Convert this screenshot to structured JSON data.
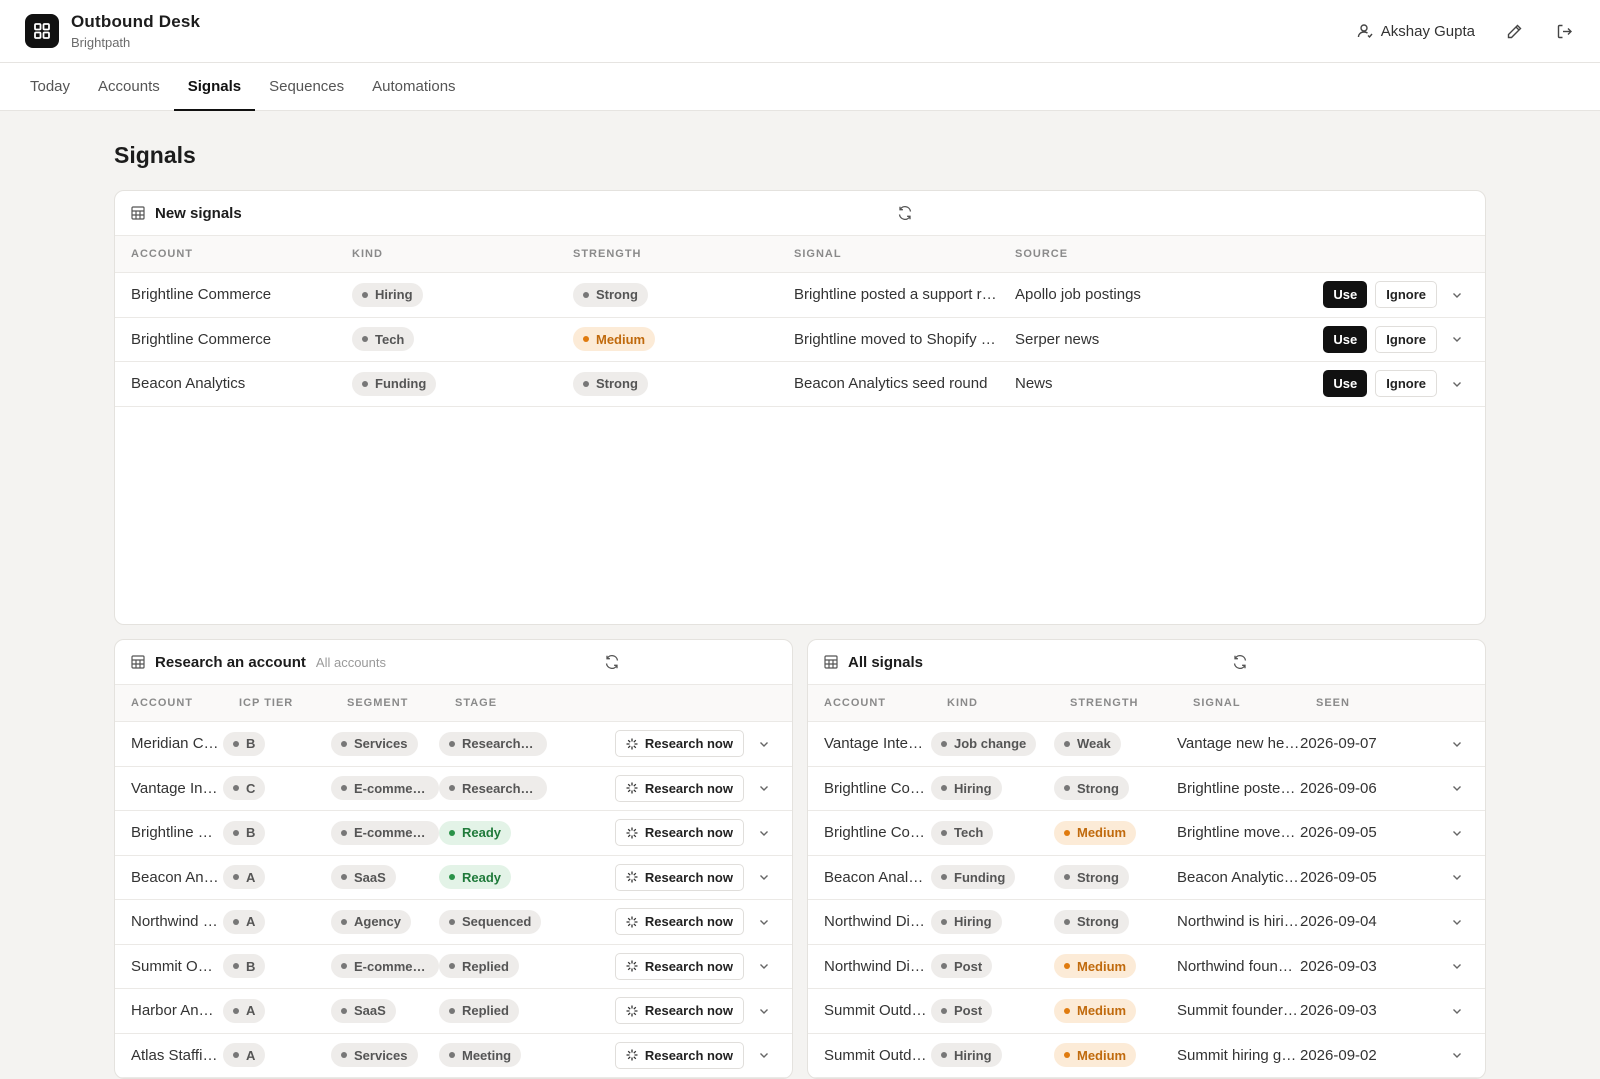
{
  "app": {
    "title": "Outbound Desk",
    "workspace": "Brightpath",
    "user": "Akshay Gupta"
  },
  "tabs": [
    {
      "label": "Today",
      "active": false
    },
    {
      "label": "Accounts",
      "active": false
    },
    {
      "label": "Signals",
      "active": true
    },
    {
      "label": "Sequences",
      "active": false
    },
    {
      "label": "Automations",
      "active": false
    }
  ],
  "page_title": "Signals",
  "new_signals": {
    "title": "New signals",
    "columns": [
      "ACCOUNT",
      "KIND",
      "STRENGTH",
      "SIGNAL",
      "SOURCE"
    ],
    "use_label": "Use",
    "ignore_label": "Ignore",
    "rows": [
      {
        "account": "Brightline Commerce",
        "kind": "Hiring",
        "strength": "Strong",
        "signal": "Brightline posted a support role",
        "source": "Apollo job postings"
      },
      {
        "account": "Brightline Commerce",
        "kind": "Tech",
        "strength": "Medium",
        "signal": "Brightline moved to Shopify Plus",
        "source": "Serper news"
      },
      {
        "account": "Beacon Analytics",
        "kind": "Funding",
        "strength": "Strong",
        "signal": "Beacon Analytics seed round",
        "source": "News"
      }
    ]
  },
  "research": {
    "title": "Research an account",
    "subtitle": "All accounts",
    "columns": [
      "ACCOUNT",
      "ICP TIER",
      "SEGMENT",
      "STAGE"
    ],
    "button_label": "Research now",
    "rows": [
      {
        "account": "Meridian Consulting",
        "tier": "B",
        "segment": "Services",
        "stage": "Researching"
      },
      {
        "account": "Vantage Interiors",
        "tier": "C",
        "segment": "E-commerce",
        "stage": "Researching"
      },
      {
        "account": "Brightline Commerce",
        "tier": "B",
        "segment": "E-commerce",
        "stage": "Ready"
      },
      {
        "account": "Beacon Analytics",
        "tier": "A",
        "segment": "SaaS",
        "stage": "Ready"
      },
      {
        "account": "Northwind Digital",
        "tier": "A",
        "segment": "Agency",
        "stage": "Sequenced"
      },
      {
        "account": "Summit Outdoors",
        "tier": "B",
        "segment": "E-commerce",
        "stage": "Replied"
      },
      {
        "account": "Harbor Analytics",
        "tier": "A",
        "segment": "SaaS",
        "stage": "Replied"
      },
      {
        "account": "Atlas Staffing",
        "tier": "A",
        "segment": "Services",
        "stage": "Meeting"
      }
    ]
  },
  "all_signals": {
    "title": "All signals",
    "columns": [
      "ACCOUNT",
      "KIND",
      "STRENGTH",
      "SIGNAL",
      "SEEN"
    ],
    "rows": [
      {
        "account": "Vantage Interiors",
        "kind": "Job change",
        "strength": "Weak",
        "signal": "Vantage new head of ops",
        "seen": "2026-09-07"
      },
      {
        "account": "Brightline Commerce",
        "kind": "Hiring",
        "strength": "Strong",
        "signal": "Brightline posted a support role",
        "seen": "2026-09-06"
      },
      {
        "account": "Brightline Commerce",
        "kind": "Tech",
        "strength": "Medium",
        "signal": "Brightline moved to Shopify Plus",
        "seen": "2026-09-05"
      },
      {
        "account": "Beacon Analytics",
        "kind": "Funding",
        "strength": "Strong",
        "signal": "Beacon Analytics seed round",
        "seen": "2026-09-05"
      },
      {
        "account": "Northwind Digital",
        "kind": "Hiring",
        "strength": "Strong",
        "signal": "Northwind is hiring SDRs",
        "seen": "2026-09-04"
      },
      {
        "account": "Northwind Digital",
        "kind": "Post",
        "strength": "Medium",
        "signal": "Northwind founder post",
        "seen": "2026-09-03"
      },
      {
        "account": "Summit Outdoors",
        "kind": "Post",
        "strength": "Medium",
        "signal": "Summit founder post",
        "seen": "2026-09-03"
      },
      {
        "account": "Summit Outdoors",
        "kind": "Hiring",
        "strength": "Medium",
        "signal": "Summit hiring growth lead",
        "seen": "2026-09-02"
      }
    ]
  },
  "colors": {
    "accent": "#111111",
    "medium": "#e07b0f",
    "ready": "#2a9248",
    "background": "#f4f3f1"
  }
}
